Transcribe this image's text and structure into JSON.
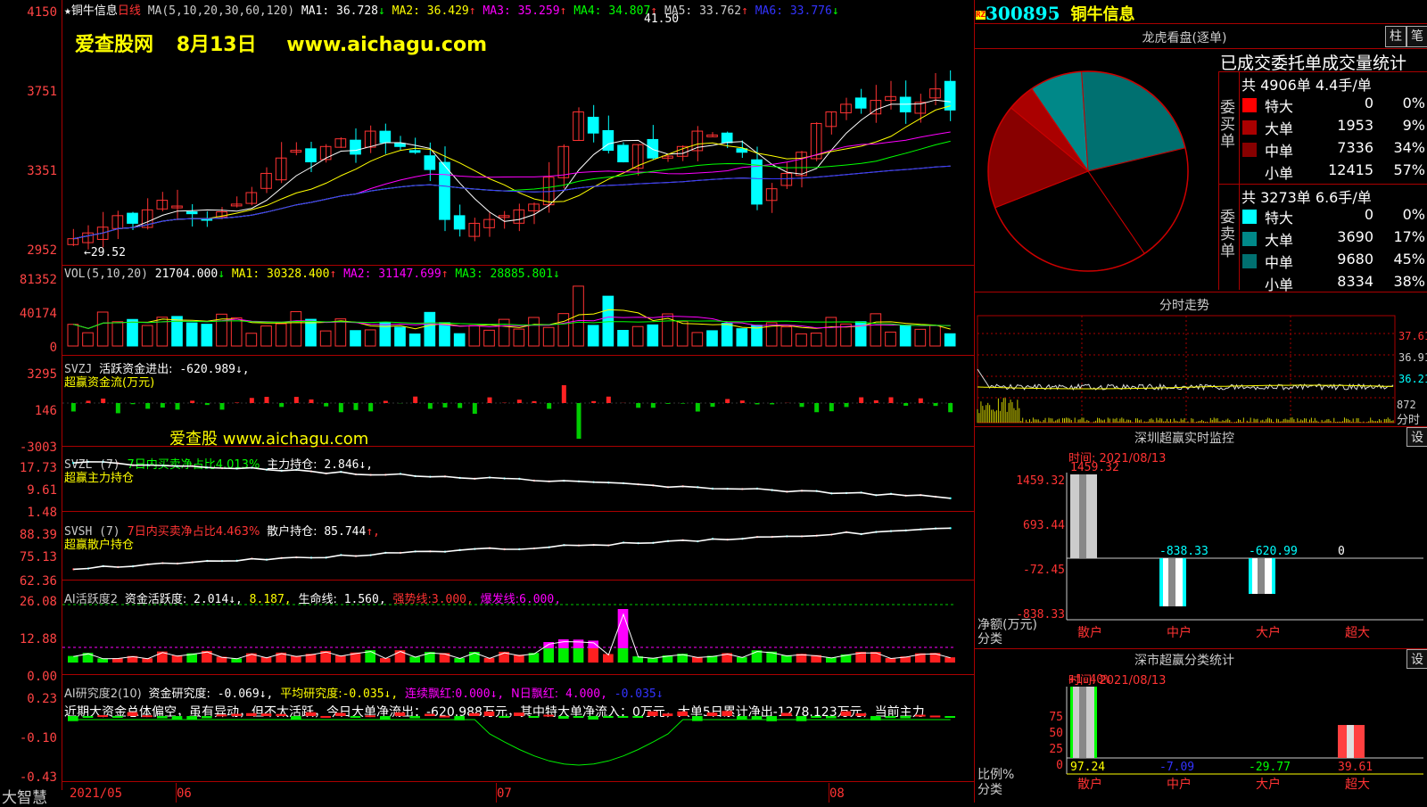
{
  "stock": {
    "code": "300895",
    "name": "铜牛信息",
    "rz_badge": "RZ",
    "period": "日线"
  },
  "main_chart": {
    "ma_header": "MA(5,10,20,30,60,120)",
    "ma": [
      {
        "label": "MA1:",
        "value": "36.728",
        "arrow": "↓",
        "color": "#ffffff"
      },
      {
        "label": "MA2:",
        "value": "36.429",
        "arrow": "↑",
        "color": "#ffff00"
      },
      {
        "label": "MA3:",
        "value": "35.259",
        "arrow": "↑",
        "color": "#ff00ff"
      },
      {
        "label": "MA4:",
        "value": "34.807",
        "arrow": "↑",
        "color": "#00ff00"
      },
      {
        "label": "MA5:",
        "value": "33.762",
        "arrow": "↑",
        "color": "#cccccc"
      },
      {
        "label": "MA6:",
        "value": "33.776",
        "arrow": "↓",
        "color": "#3333ff"
      }
    ],
    "y_labels": [
      "4150",
      "3751",
      "3351",
      "2952"
    ],
    "high_marker": "41.50",
    "low_marker": "←29.52",
    "banner": {
      "site": "爱查股网",
      "date": "8月13日",
      "url": "www.aichagu.com"
    }
  },
  "vol_panel": {
    "header": "VOL(5,10,20)",
    "value": "21704.000",
    "value_arrow": "↓",
    "ma": [
      {
        "label": "MA1:",
        "value": "30328.400",
        "arrow": "↑"
      },
      {
        "label": "MA2:",
        "value": "31147.699",
        "arrow": "↑"
      },
      {
        "label": "MA3:",
        "value": "28885.801",
        "arrow": "↓"
      }
    ],
    "y_labels": [
      "81352",
      "40174",
      "0"
    ]
  },
  "svzj_panel": {
    "name": "SVZJ",
    "label": "活跃资金进出:",
    "value": "-620.989",
    "arrow": "↓,",
    "subtitle": "超赢资金流(万元)",
    "watermark": "爱查股 www.aichagu.com",
    "y_labels": [
      "3295",
      "146",
      "-3003"
    ]
  },
  "svzl_panel": {
    "name": "SVZL (7)",
    "ratio_label": "7日内买卖净占比4.013%",
    "label": "主力持仓:",
    "value": "2.846",
    "arrow": "↓,",
    "subtitle": "超赢主力持仓",
    "y_labels": [
      "17.73",
      "9.61",
      "1.48"
    ]
  },
  "svsh_panel": {
    "name": "SVSH (7)",
    "ratio_label": "7日内买卖净占比4.463%",
    "label": "散户持仓:",
    "value": "85.744",
    "arrow": "↑,",
    "subtitle": "超赢散户持仓",
    "y_labels": [
      "88.39",
      "75.13",
      "62.36"
    ]
  },
  "ai_active_panel": {
    "name": "AI活跃度2",
    "label": "资金活跃度:",
    "value": "2.014",
    "arrow": "↓,",
    "v2": "8.187,",
    "life_label": "生命线:",
    "life_value": "1.560,",
    "strong_label": "强势线:",
    "strong_value": "3.000,",
    "burst_label": "爆发线:",
    "burst_value": "6.000,",
    "y_labels": [
      "26.08",
      "12.88",
      "0.00"
    ]
  },
  "ai_research_panel": {
    "name": "AI研究度2(10)",
    "label": "资金研究度:",
    "value": "-0.069",
    "arrow": "↓,",
    "avg_label": "平均研究度:",
    "avg_value": "-0.035",
    "avg_arrow": "↓,",
    "red_label": "连续飘红:",
    "red_value": "0.000",
    "red_arrow": "↓,",
    "n_label": "N日飘红:",
    "n_value": "4.000,",
    "n2": "-0.035",
    "n2_arrow": "↓",
    "comment": "近期大资金总体偏空，虽有异动，但不太活跃，今日大单净流出：-620.988万元，其中特大单净流入：0万元，大单5日累计净出-1278.123万元，当前主力",
    "y_labels": [
      "0.23",
      "-0.10",
      "-0.43"
    ]
  },
  "x_axis": {
    "brand": "大智慧",
    "labels": [
      "2021/05",
      "06",
      "07",
      "08"
    ]
  },
  "colors": {
    "up": "#ff3333",
    "down": "#00ffff",
    "axis": "#aa0000",
    "label": "#ff4444"
  },
  "dragon_tiger": {
    "title": "龙虎看盘(逐单)",
    "buttons": [
      "柱",
      "笔"
    ],
    "stats_title": "已成交委托单成交量统计",
    "buy": {
      "side_label": "委买单",
      "summary": "共 4906单 4.4手/单",
      "rows": [
        {
          "name": "特大",
          "count": "0",
          "pct": "0%",
          "color": "#ff0000"
        },
        {
          "name": "大单",
          "count": "1953",
          "pct": "9%",
          "color": "#aa0000"
        },
        {
          "name": "中单",
          "count": "7336",
          "pct": "34%",
          "color": "#880000"
        },
        {
          "name": "小单",
          "count": "12415",
          "pct": "57%",
          "color": "#000000"
        }
      ]
    },
    "sell": {
      "side_label": "委卖单",
      "summary": "共 3273单 6.6手/单",
      "rows": [
        {
          "name": "特大",
          "count": "0",
          "pct": "0%",
          "color": "#00ffff"
        },
        {
          "name": "大单",
          "count": "3690",
          "pct": "17%",
          "color": "#008888"
        },
        {
          "name": "中单",
          "count": "9680",
          "pct": "45%",
          "color": "#007070"
        },
        {
          "name": "小单",
          "count": "8334",
          "pct": "38%",
          "color": "#000000"
        }
      ]
    }
  },
  "intraday": {
    "title": "分时走势",
    "right_labels": [
      "37.61",
      "36.91",
      "36.21"
    ],
    "vol_label": "872",
    "vol_unit": "分时"
  },
  "sz_monitor": {
    "title": "深圳超赢实时监控",
    "button": "设",
    "time": "时间: 2021/08/13",
    "y_labels": [
      "1459.32",
      "693.44",
      "-72.45",
      "-838.33"
    ],
    "y_caption": "净额(万元)",
    "x_caption": "分类",
    "categories": [
      "散户",
      "中户",
      "大户",
      "超大"
    ],
    "values": [
      1459.32,
      -838.33,
      -620.99,
      0
    ],
    "value_labels": [
      "1459.32",
      "-838.33",
      "-620.99",
      "0"
    ]
  },
  "sz_class": {
    "title": "深市超赢分类统计",
    "button": "设",
    "time": "时间: 2021/08/13",
    "y_labels": [
      "75",
      "50",
      "25",
      "0"
    ],
    "top_label": "+1.40%",
    "y_caption": "比例%",
    "x_caption": "分类",
    "categories": [
      "散户",
      "中户",
      "大户",
      "超大"
    ],
    "values": [
      97.24,
      -7.09,
      -29.77,
      39.61
    ],
    "value_labels": [
      "97.24",
      "-7.09",
      "-29.77",
      "39.61"
    ]
  },
  "chart_data": {
    "type": "candlestick",
    "title": "铜牛信息 日线",
    "ylim": [
      29.52,
      41.5
    ],
    "series": [
      {
        "name": "price"
      }
    ]
  }
}
